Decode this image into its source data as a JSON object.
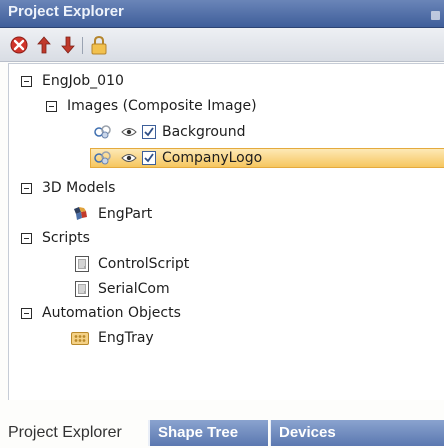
{
  "window": {
    "title": "Project Explorer"
  },
  "toolbar": {
    "buttons": [
      {
        "icon": "remove-icon",
        "color": "#d0352b"
      },
      {
        "icon": "move-up-icon",
        "color": "#c0392b"
      },
      {
        "icon": "move-down-icon",
        "color": "#c0392b"
      },
      {
        "icon": "lock-icon",
        "color": "#e0a93a"
      }
    ]
  },
  "tree": {
    "root": {
      "label": "EngJob_010"
    },
    "images_group": {
      "label": "Images (Composite Image)"
    },
    "background": {
      "label": "Background",
      "checked": true
    },
    "company_logo": {
      "label": "CompanyLogo",
      "checked": true,
      "selected": true
    },
    "models_group": {
      "label": "3D Models"
    },
    "eng_part": {
      "label": "EngPart"
    },
    "scripts_group": {
      "label": "Scripts"
    },
    "control_script": {
      "label": "ControlScript"
    },
    "serial_com": {
      "label": "SerialCom"
    },
    "automation_group": {
      "label": "Automation Objects"
    },
    "eng_tray": {
      "label": "EngTray"
    }
  },
  "tabs": {
    "active": "Project Explorer",
    "items": [
      "Shape Tree",
      "Devices"
    ]
  },
  "colors": {
    "titlebar": "#4f6ca6",
    "selection": "#f7c85a",
    "tab": "#6a86bd"
  }
}
